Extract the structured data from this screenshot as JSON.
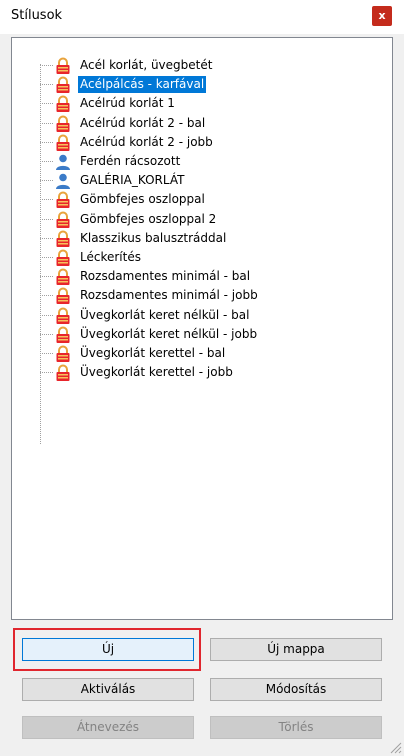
{
  "window": {
    "title": "Stílusok",
    "close_label": "x"
  },
  "tree": {
    "items": [
      {
        "label": "Acél korlát, üvegbetét",
        "icon": "lock-icon",
        "selected": false
      },
      {
        "label": "Acélpálcás - karfával",
        "icon": "lock-icon",
        "selected": true
      },
      {
        "label": "Acélrúd korlát 1",
        "icon": "lock-icon",
        "selected": false
      },
      {
        "label": "Acélrúd korlát 2 - bal",
        "icon": "lock-icon",
        "selected": false
      },
      {
        "label": "Acélrúd korlát 2 - jobb",
        "icon": "lock-icon",
        "selected": false
      },
      {
        "label": "Ferdén rácsozott",
        "icon": "user-icon",
        "selected": false
      },
      {
        "label": "GALÉRIA_KORLÁT",
        "icon": "user-icon",
        "selected": false
      },
      {
        "label": "Gömbfejes oszloppal",
        "icon": "lock-icon",
        "selected": false
      },
      {
        "label": "Gömbfejes oszloppal 2",
        "icon": "lock-icon",
        "selected": false
      },
      {
        "label": "Klasszikus balusztráddal",
        "icon": "lock-icon",
        "selected": false
      },
      {
        "label": "Léckerítés",
        "icon": "lock-icon",
        "selected": false
      },
      {
        "label": "Rozsdamentes minimál - bal",
        "icon": "lock-icon",
        "selected": false
      },
      {
        "label": "Rozsdamentes minimál - jobb",
        "icon": "lock-icon",
        "selected": false
      },
      {
        "label": "Üvegkorlát keret nélkül - bal",
        "icon": "lock-icon",
        "selected": false
      },
      {
        "label": "Üvegkorlát keret nélkül - jobb",
        "icon": "lock-icon",
        "selected": false
      },
      {
        "label": "Üvegkorlát kerettel - bal",
        "icon": "lock-icon",
        "selected": false
      },
      {
        "label": "Üvegkorlát kerettel - jobb",
        "icon": "lock-icon",
        "selected": false
      }
    ]
  },
  "buttons": {
    "new": "Új",
    "new_folder": "Új mappa",
    "activate": "Aktiválás",
    "modify": "Módosítás",
    "rename": "Átnevezés",
    "delete": "Törlés"
  },
  "colors": {
    "selection": "#0078d7",
    "focus_ring": "#e0262e",
    "close": "#c42b1c",
    "lock_body": "#e8252b",
    "lock_shackle": "#e8a33c",
    "user_icon": "#3b7bc8"
  }
}
